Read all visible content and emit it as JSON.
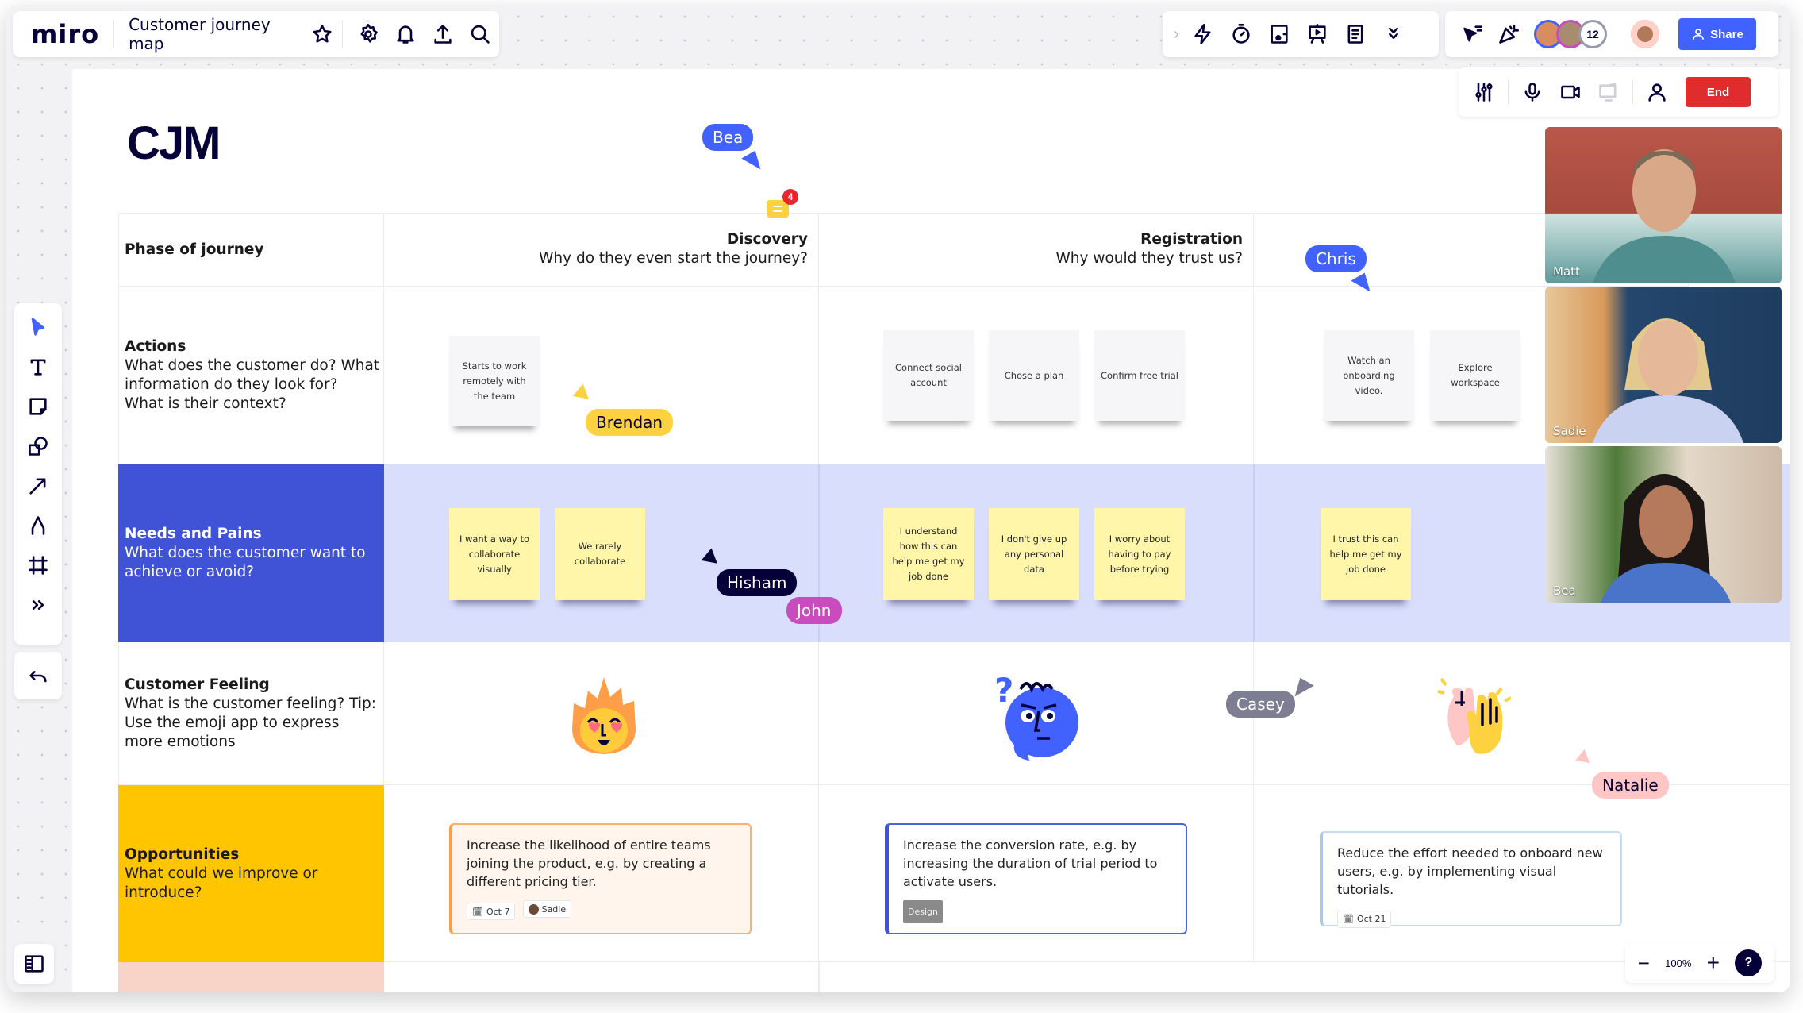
{
  "app": {
    "logo": "miro",
    "board_title": "Customer journey map"
  },
  "top_toolbar": {
    "collaborators_extra_count": "12",
    "share_label": "Share"
  },
  "call_bar": {
    "end_label": "End"
  },
  "zoom": {
    "level": "100%",
    "help": "?"
  },
  "board": {
    "title": "CJM",
    "comment_badge_count": "4",
    "rows": {
      "phase": {
        "title": "Phase of journey"
      },
      "actions": {
        "title": "Actions",
        "desc": "What does the customer do? What information do they look for? What is their context?"
      },
      "needs": {
        "title": "Needs and Pains",
        "desc": "What does the customer want to achieve or avoid?"
      },
      "feeling": {
        "title": "Customer Feeling",
        "desc": "What is the customer feeling? Tip: Use the emoji app to express more emotions"
      },
      "opportunities": {
        "title": "Opportunities",
        "desc": "What could we improve or introduce?"
      }
    },
    "phases": [
      {
        "title": "Discovery",
        "subtitle": "Why do they even start the journey?"
      },
      {
        "title": "Registration",
        "subtitle": "Why would they trust us?"
      }
    ],
    "action_cards": [
      "Starts to work remotely with the team",
      "Connect  social account",
      "Chose a plan",
      "Confirm free trial",
      "Watch an onboarding video.",
      "Explore workspace"
    ],
    "stickies": [
      "I want a way to collaborate visually",
      "We rarely collaborate",
      "I understand how this can help me get my job done",
      "I don't give up any personal data",
      "I worry about having to pay before trying",
      "I trust this can help me get my job done"
    ],
    "opportunities": [
      {
        "text": "Increase the likelihood of entire teams joining the product, e.g. by creating a different pricing tier.",
        "date": "Oct 7",
        "assignee": "Sadie"
      },
      {
        "text": "Increase the conversion rate, e.g. by increasing the duration of trial period to activate users.",
        "tag": "Design"
      },
      {
        "text": "Reduce the effort needed to onboard new users, e.g. by implementing visual tutorials.",
        "date": "Oct 21"
      }
    ]
  },
  "cursors": [
    {
      "name": "Bea",
      "color": "#4262ff"
    },
    {
      "name": "Chris",
      "color": "#4262ff"
    },
    {
      "name": "Brendan",
      "color": "#fdd13f"
    },
    {
      "name": "Hisham",
      "color": "#050038"
    },
    {
      "name": "John",
      "color": "#c94bbd"
    },
    {
      "name": "Casey",
      "color": "#7d7d93"
    },
    {
      "name": "Natalie",
      "color": "#ffc6c6"
    }
  ],
  "video_participants": [
    {
      "name": "Matt"
    },
    {
      "name": "Sadie"
    },
    {
      "name": "Bea"
    }
  ],
  "colors": {
    "accent": "#4262ff",
    "needs_row": "#4053d6",
    "needs_band": "#d8defc",
    "opps_row": "#ffc600",
    "end": "#e02c2c"
  }
}
